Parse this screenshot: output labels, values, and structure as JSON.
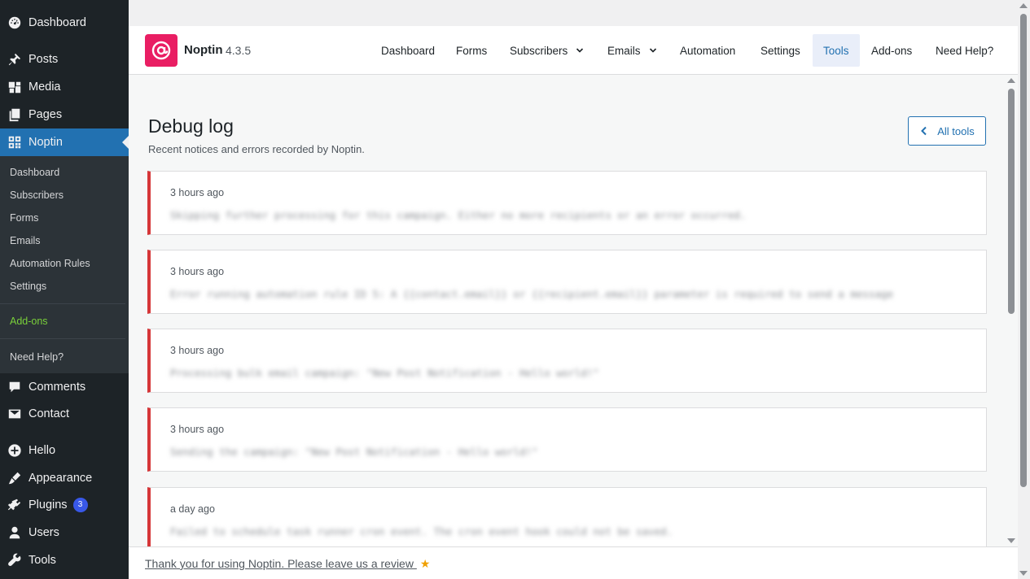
{
  "sidebar": {
    "items": [
      {
        "label": "Dashboard",
        "icon": "dashboard-icon"
      },
      {
        "label": "Posts",
        "icon": "pin-icon"
      },
      {
        "label": "Media",
        "icon": "media-icon"
      },
      {
        "label": "Pages",
        "icon": "pages-icon"
      },
      {
        "label": "Noptin",
        "icon": "grid-icon"
      },
      {
        "label": "Comments",
        "icon": "comment-icon"
      },
      {
        "label": "Contact",
        "icon": "mail-icon"
      },
      {
        "label": "Hello",
        "icon": "plus-circle-icon"
      },
      {
        "label": "Appearance",
        "icon": "brush-icon"
      },
      {
        "label": "Plugins",
        "icon": "plug-icon",
        "badge": "3"
      },
      {
        "label": "Users",
        "icon": "user-icon"
      },
      {
        "label": "Tools",
        "icon": "wrench-icon"
      }
    ],
    "submenu": [
      "Dashboard",
      "Subscribers",
      "Forms",
      "Emails",
      "Automation Rules",
      "Settings",
      "Add-ons",
      "Need Help?"
    ]
  },
  "header": {
    "brand": "Noptin",
    "version": "4.3.5",
    "nav": [
      "Dashboard",
      "Forms",
      "Subscribers",
      "Emails",
      "Automation",
      "Settings",
      "Tools",
      "Add-ons",
      "Need Help?"
    ],
    "active_nav": "Tools"
  },
  "main": {
    "title": "Debug log",
    "description": "Recent notices and errors recorded by Noptin.",
    "all_tools_label": "All tools",
    "logs": [
      {
        "time": "3 hours ago",
        "message": "Skipping further processing for this campaign. Either no more recipients or an error occurred."
      },
      {
        "time": "3 hours ago",
        "message": "Error running automation rule ID 5: A {{contact.email}} or {{recipient.email}} parameter is required to send a message"
      },
      {
        "time": "3 hours ago",
        "message": "Processing bulk email campaign: \"New Post Notification - Hello world!\""
      },
      {
        "time": "3 hours ago",
        "message": "Sending the campaign: \"New Post Notification - Hello world!\""
      },
      {
        "time": "a day ago",
        "message": "Failed to schedule task runner cron event. The cron event hook could not be saved."
      }
    ]
  },
  "footer": {
    "text": "Thank you for using Noptin. Please leave us a review",
    "star": "★"
  },
  "colors": {
    "sidebar_bg": "#1d2327",
    "accent": "#2271b1",
    "logo": "#e91e63",
    "error_border": "#d63638",
    "addons_green": "#7ad03a"
  }
}
